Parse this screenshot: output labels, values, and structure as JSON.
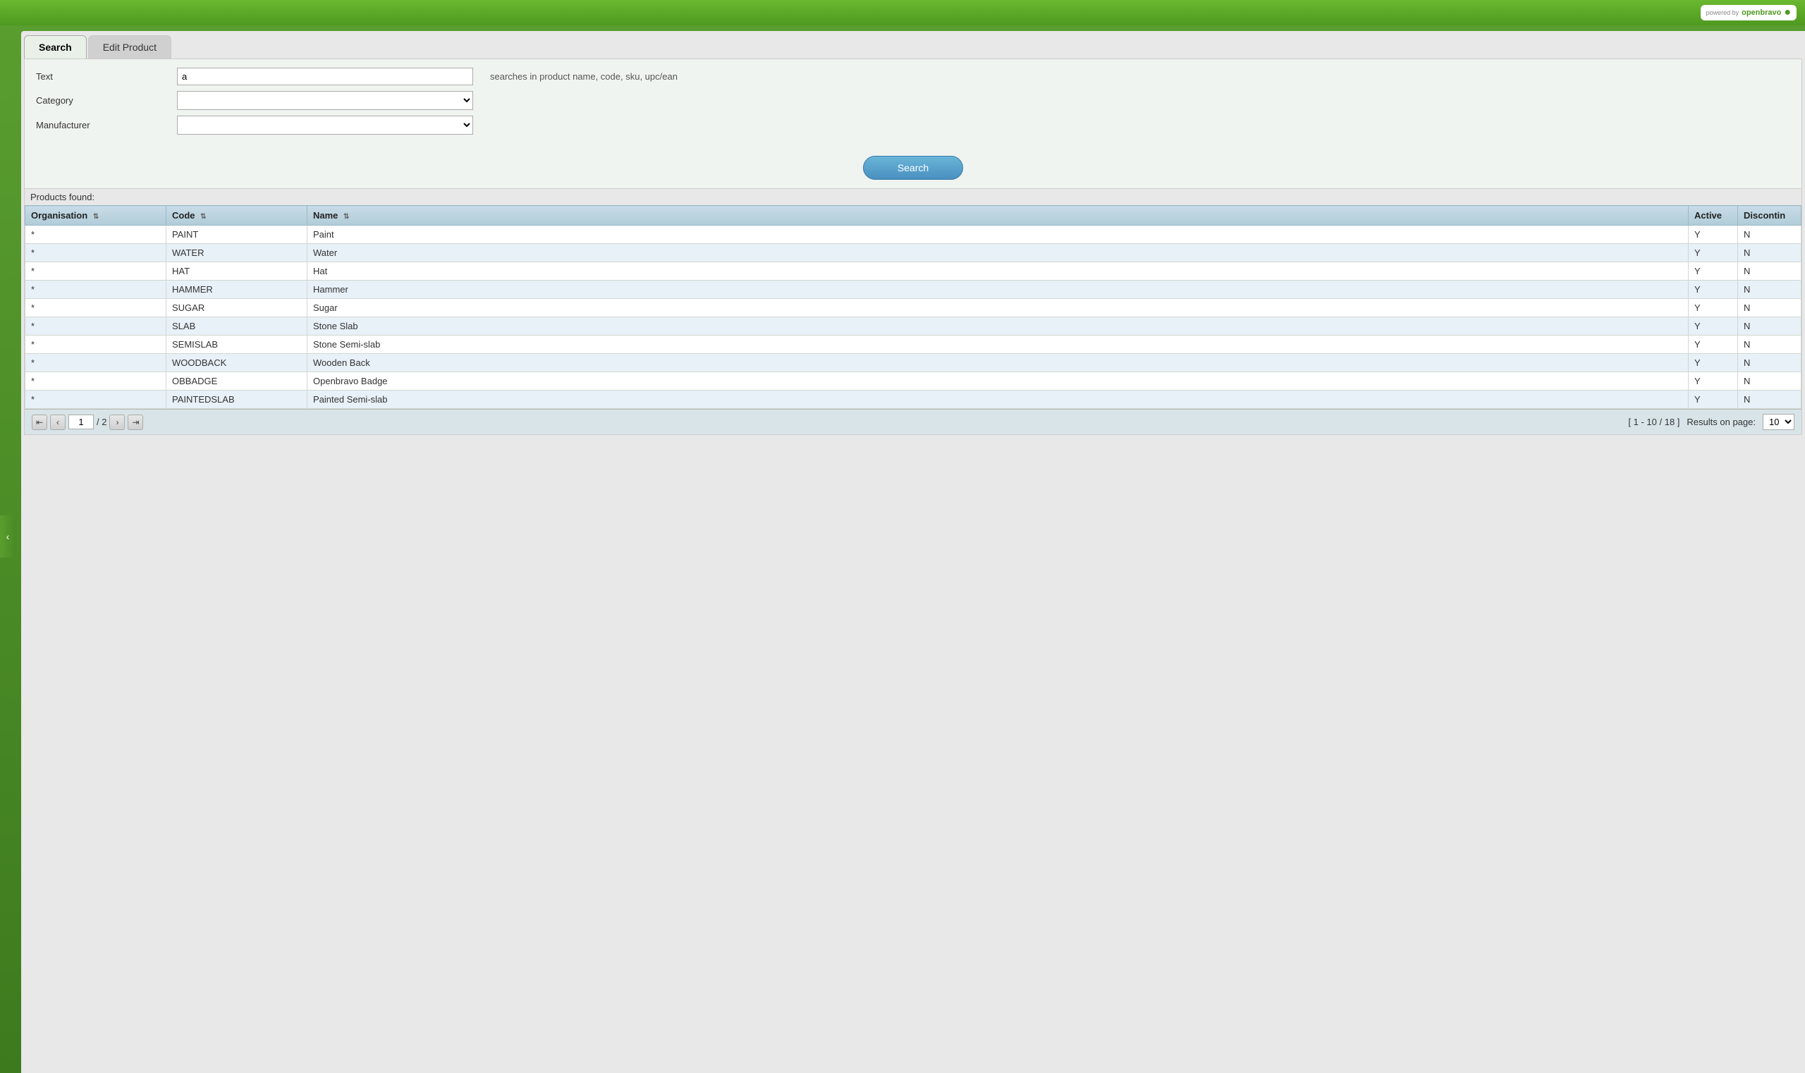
{
  "topbar": {
    "powered_by": "powered by",
    "brand": "openbravo"
  },
  "tabs": [
    {
      "id": "search",
      "label": "Search",
      "active": true
    },
    {
      "id": "edit-product",
      "label": "Edit Product",
      "active": false
    }
  ],
  "form": {
    "text_label": "Text",
    "text_value": "a",
    "text_hint": "searches in product name, code, sku, upc/ean",
    "category_label": "Category",
    "category_placeholder": "",
    "manufacturer_label": "Manufacturer",
    "manufacturer_placeholder": "",
    "search_button": "Search"
  },
  "results": {
    "label": "Products found:",
    "columns": [
      {
        "id": "org",
        "label": "Organisation"
      },
      {
        "id": "code",
        "label": "Code"
      },
      {
        "id": "name",
        "label": "Name"
      },
      {
        "id": "active",
        "label": "Active"
      },
      {
        "id": "discontin",
        "label": "Discontin"
      }
    ],
    "rows": [
      {
        "org": "*",
        "code": "PAINT",
        "name": "Paint",
        "active": "Y",
        "discontin": "N"
      },
      {
        "org": "*",
        "code": "WATER",
        "name": "Water",
        "active": "Y",
        "discontin": "N"
      },
      {
        "org": "*",
        "code": "HAT",
        "name": "Hat",
        "active": "Y",
        "discontin": "N"
      },
      {
        "org": "*",
        "code": "HAMMER",
        "name": "Hammer",
        "active": "Y",
        "discontin": "N"
      },
      {
        "org": "*",
        "code": "SUGAR",
        "name": "Sugar",
        "active": "Y",
        "discontin": "N"
      },
      {
        "org": "*",
        "code": "SLAB",
        "name": "Stone Slab",
        "active": "Y",
        "discontin": "N"
      },
      {
        "org": "*",
        "code": "SEMISLAB",
        "name": "Stone Semi-slab",
        "active": "Y",
        "discontin": "N"
      },
      {
        "org": "*",
        "code": "WOODBACK",
        "name": "Wooden Back",
        "active": "Y",
        "discontin": "N"
      },
      {
        "org": "*",
        "code": "OBBADGE",
        "name": "Openbravo Badge",
        "active": "Y",
        "discontin": "N"
      },
      {
        "org": "*",
        "code": "PAINTEDSLAB",
        "name": "Painted Semi-slab",
        "active": "Y",
        "discontin": "N"
      }
    ]
  },
  "pagination": {
    "current_page": "1",
    "total_pages": "2",
    "range_text": "[ 1 - 10 / 18 ]",
    "results_label": "Results on page:",
    "per_page": "10"
  }
}
